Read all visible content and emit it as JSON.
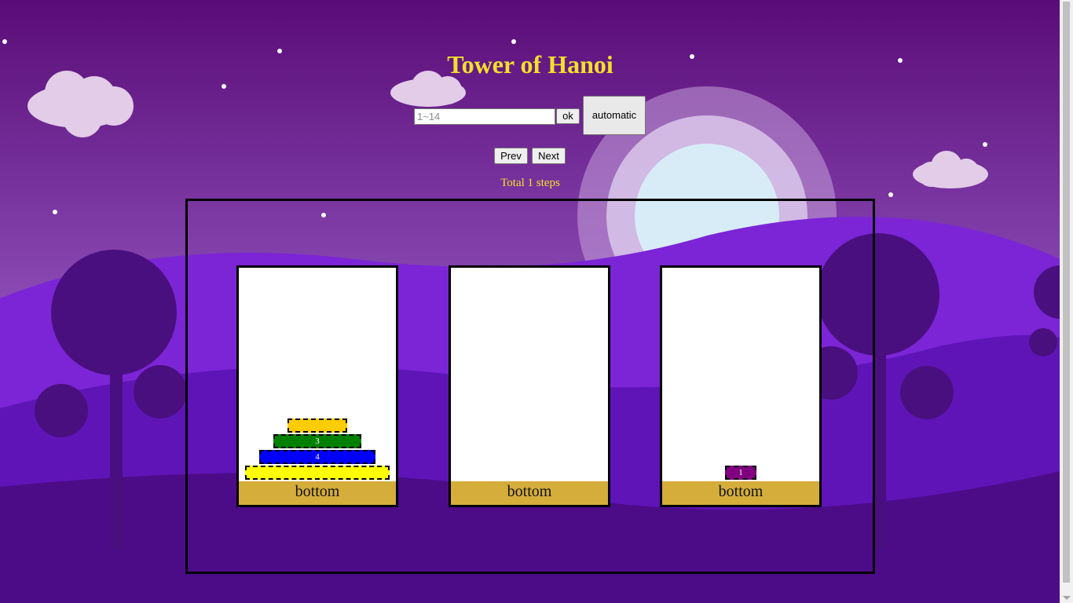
{
  "title": "Tower of Hanoi",
  "controls": {
    "input_placeholder": "1~14",
    "input_value": "",
    "ok_label": "ok",
    "automatic_label": "automatic",
    "prev_label": "Prev",
    "next_label": "Next"
  },
  "status": {
    "steps_text": "Total 1 steps"
  },
  "towers": [
    {
      "base_label": "bottom",
      "disks": [
        {
          "label": "",
          "color": "#ffff00"
        },
        {
          "label": "4",
          "color": "#0000ff"
        },
        {
          "label": "3",
          "color": "#008000"
        },
        {
          "label": "",
          "color": "#ffcc00"
        }
      ]
    },
    {
      "base_label": "bottom",
      "disks": []
    },
    {
      "base_label": "bottom",
      "disks": [
        {
          "label": "1",
          "color": "#800080"
        }
      ]
    }
  ],
  "colors": {
    "title": "#f4e02a",
    "base": "#d4ad3b",
    "sky_top": "#5a0c78",
    "moon": "#d8ecf8"
  }
}
